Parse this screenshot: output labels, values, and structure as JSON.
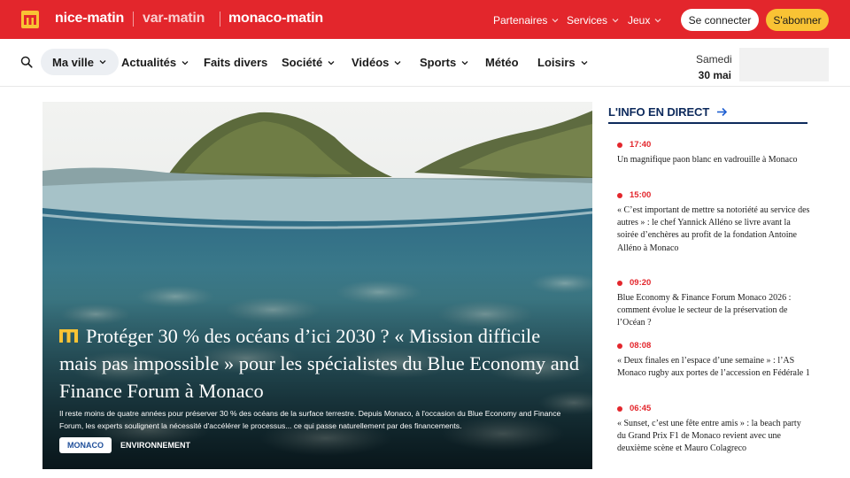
{
  "topbar": {
    "brands": [
      "nice-matin",
      "var-matin",
      "monaco-matin"
    ],
    "links": [
      {
        "label": "Partenaires",
        "icon": "chevron-down-icon"
      },
      {
        "label": "Services",
        "icon": "chevron-down-icon"
      },
      {
        "label": "Jeux",
        "icon": "chevron-down-icon"
      }
    ],
    "connect_label": "Se connecter",
    "subscribe_label": "S'abonner",
    "colors": {
      "brand_red": "#e3262c",
      "subscribe_yellow": "#f9c334"
    }
  },
  "nav": {
    "search_icon": "search-icon",
    "items": [
      {
        "label": "Ma ville",
        "dropdown": true,
        "active": true
      },
      {
        "label": "Actualités",
        "dropdown": true
      },
      {
        "label": "Faits divers",
        "dropdown": false
      },
      {
        "label": "Société",
        "dropdown": true
      },
      {
        "label": "Vidéos",
        "dropdown": true
      },
      {
        "label": "Sports",
        "dropdown": true
      },
      {
        "label": "Météo",
        "dropdown": false
      },
      {
        "label": "Loisirs",
        "dropdown": true
      }
    ],
    "date_day": "Samedi",
    "date_num": "30 mai"
  },
  "hero": {
    "title": "Protéger 30 % des océans d’ici 2030 ? « Mission difficile mais pas impossible » pour les spécialistes du Blue Economy and Finance Forum à Monaco",
    "description": "Il reste moins de quatre années pour préserver 30 % des océans de la surface terrestre. Depuis Monaco, à l'occasion du Blue Economy and Finance Forum, les experts soulignent la nécessité d'accélérer le processus... ce qui passe naturellement par des financements.",
    "tag_primary": "MONACO",
    "tag_secondary": "ENVIRONNEMENT"
  },
  "live": {
    "title": "L'INFO EN DIRECT",
    "accent": "#0d2a5c",
    "items": [
      {
        "time": "17:40",
        "text": "Un magnifique paon blanc en vadrouille à Monaco"
      },
      {
        "time": "15:00",
        "text": "« C’est important de mettre sa notoriété au service des autres » : le chef Yannick Alléno se livre avant la soirée d’enchères au profit de la fondation Antoine Alléno à Monaco"
      },
      {
        "time": "09:20",
        "text": "Blue Economy & Finance Forum Monaco 2026 : comment évolue le secteur de la préservation de l’Océan ?"
      },
      {
        "time": "08:08",
        "text": "« Deux finales en l’espace d’une semaine » : l’AS Monaco rugby aux portes de l’accession en Fédérale 1"
      },
      {
        "time": "06:45",
        "text": "« Sunset, c’est une fête entre amis » : la beach party du Grand Prix F1 de Monaco revient avec une deuxième scène et Mauro Colagreco"
      }
    ]
  }
}
